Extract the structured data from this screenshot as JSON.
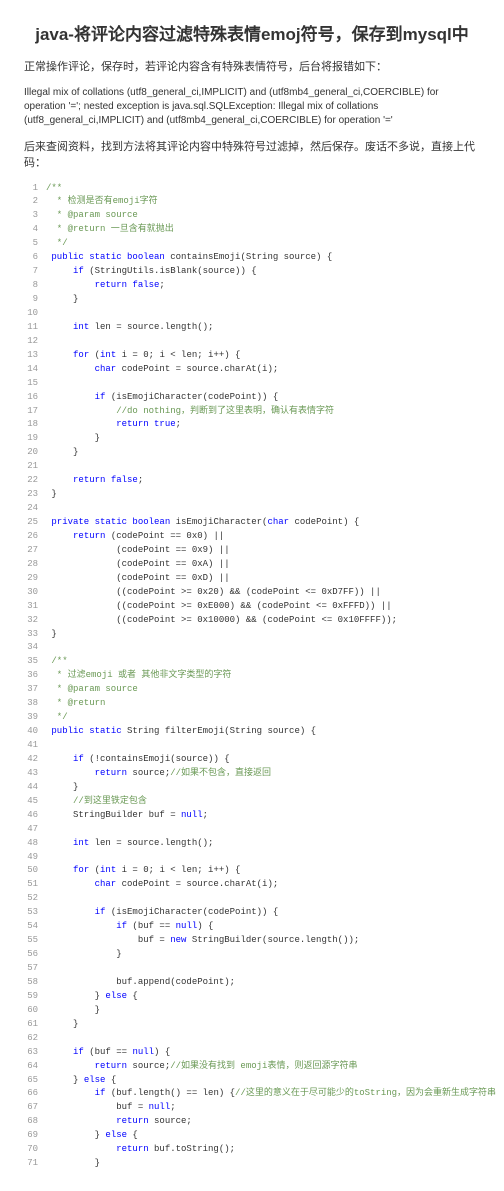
{
  "title": "java-将评论内容过滤特殊表情emoj符号，保存到mysql中",
  "intro": "正常操作评论，保存时，若评论内容含有特殊表情符号，后台将报错如下：",
  "error": "Illegal mix of collations (utf8_general_ci,IMPLICIT) and (utf8mb4_general_ci,COERCIBLE) for operation '='; nested exception is java.sql.SQLException: Illegal mix of collations (utf8_general_ci,IMPLICIT) and (utf8mb4_general_ci,COERCIBLE) for operation '='",
  "outro": "后来查阅资料，找到方法将其评论内容中特殊符号过滤掉，然后保存。废话不多说，直接上代码：",
  "code": [
    {
      "n": 1,
      "h": "<span class='cm'>/**</span>"
    },
    {
      "n": 2,
      "h": "<span class='cm'>  * 检测是否有emoji字符</span>"
    },
    {
      "n": 3,
      "h": "<span class='cm'>  * @param source</span>"
    },
    {
      "n": 4,
      "h": "<span class='cm'>  * @return 一旦含有就抛出</span>"
    },
    {
      "n": 5,
      "h": "<span class='cm'>  */</span>"
    },
    {
      "n": 6,
      "h": " <span class='kw'>public static boolean</span> containsEmoji(String source) {"
    },
    {
      "n": 7,
      "h": "     <span class='kw'>if</span> (StringUtils.isBlank(source)) {"
    },
    {
      "n": 8,
      "h": "         <span class='kw'>return false</span>;"
    },
    {
      "n": 9,
      "h": "     }"
    },
    {
      "n": 10,
      "h": ""
    },
    {
      "n": 11,
      "h": "     <span class='kw'>int</span> len = source.length();"
    },
    {
      "n": 12,
      "h": ""
    },
    {
      "n": 13,
      "h": "     <span class='kw'>for</span> (<span class='kw'>int</span> i = 0; i &lt; len; i++) {"
    },
    {
      "n": 14,
      "h": "         <span class='kw'>char</span> codePoint = source.charAt(i);"
    },
    {
      "n": 15,
      "h": ""
    },
    {
      "n": 16,
      "h": "         <span class='kw'>if</span> (isEmojiCharacter(codePoint)) {"
    },
    {
      "n": 17,
      "h": "             <span class='cm'>//do nothing，判断到了这里表明，确认有表情字符</span>"
    },
    {
      "n": 18,
      "h": "             <span class='kw'>return true</span>;"
    },
    {
      "n": 19,
      "h": "         }"
    },
    {
      "n": 20,
      "h": "     }"
    },
    {
      "n": 21,
      "h": ""
    },
    {
      "n": 22,
      "h": "     <span class='kw'>return false</span>;"
    },
    {
      "n": 23,
      "h": " }"
    },
    {
      "n": 24,
      "h": ""
    },
    {
      "n": 25,
      "h": " <span class='kw'>private static boolean</span> isEmojiCharacter(<span class='kw'>char</span> codePoint) {"
    },
    {
      "n": 26,
      "h": "     <span class='kw'>return</span> (codePoint == 0x0) ||"
    },
    {
      "n": 27,
      "h": "             (codePoint == 0x9) ||"
    },
    {
      "n": 28,
      "h": "             (codePoint == 0xA) ||"
    },
    {
      "n": 29,
      "h": "             (codePoint == 0xD) ||"
    },
    {
      "n": 30,
      "h": "             ((codePoint &gt;= 0x20) &amp;&amp; (codePoint &lt;= 0xD7FF)) ||"
    },
    {
      "n": 31,
      "h": "             ((codePoint &gt;= 0xE000) &amp;&amp; (codePoint &lt;= 0xFFFD)) ||"
    },
    {
      "n": 32,
      "h": "             ((codePoint &gt;= 0x10000) &amp;&amp; (codePoint &lt;= 0x10FFFF));"
    },
    {
      "n": 33,
      "h": " }"
    },
    {
      "n": 34,
      "h": ""
    },
    {
      "n": 35,
      "h": "<span class='cm'> /**</span>"
    },
    {
      "n": 36,
      "h": "<span class='cm'>  * 过滤emoji 或者 其他非文字类型的字符</span>"
    },
    {
      "n": 37,
      "h": "<span class='cm'>  * @param source</span>"
    },
    {
      "n": 38,
      "h": "<span class='cm'>  * @return</span>"
    },
    {
      "n": 39,
      "h": "<span class='cm'>  */</span>"
    },
    {
      "n": 40,
      "h": " <span class='kw'>public static</span> String filterEmoji(String source) {"
    },
    {
      "n": 41,
      "h": ""
    },
    {
      "n": 42,
      "h": "     <span class='kw'>if</span> (!containsEmoji(source)) {"
    },
    {
      "n": 43,
      "h": "         <span class='kw'>return</span> source;<span class='cm'>//如果不包含，直接返回</span>"
    },
    {
      "n": 44,
      "h": "     }"
    },
    {
      "n": 45,
      "h": "     <span class='cm'>//到这里铁定包含</span>"
    },
    {
      "n": 46,
      "h": "     StringBuilder buf = <span class='kw'>null</span>;"
    },
    {
      "n": 47,
      "h": ""
    },
    {
      "n": 48,
      "h": "     <span class='kw'>int</span> len = source.length();"
    },
    {
      "n": 49,
      "h": ""
    },
    {
      "n": 50,
      "h": "     <span class='kw'>for</span> (<span class='kw'>int</span> i = 0; i &lt; len; i++) {"
    },
    {
      "n": 51,
      "h": "         <span class='kw'>char</span> codePoint = source.charAt(i);"
    },
    {
      "n": 52,
      "h": ""
    },
    {
      "n": 53,
      "h": "         <span class='kw'>if</span> (isEmojiCharacter(codePoint)) {"
    },
    {
      "n": 54,
      "h": "             <span class='kw'>if</span> (buf == <span class='kw'>null</span>) {"
    },
    {
      "n": 55,
      "h": "                 buf = <span class='kw'>new</span> StringBuilder(source.length());"
    },
    {
      "n": 56,
      "h": "             }"
    },
    {
      "n": 57,
      "h": ""
    },
    {
      "n": 58,
      "h": "             buf.append(codePoint);"
    },
    {
      "n": 59,
      "h": "         } <span class='kw'>else</span> {"
    },
    {
      "n": 60,
      "h": "         }"
    },
    {
      "n": 61,
      "h": "     }"
    },
    {
      "n": 62,
      "h": ""
    },
    {
      "n": 63,
      "h": "     <span class='kw'>if</span> (buf == <span class='kw'>null</span>) {"
    },
    {
      "n": 64,
      "h": "         <span class='kw'>return</span> source;<span class='cm'>//如果没有找到 emoji表情，则返回源字符串</span>"
    },
    {
      "n": 65,
      "h": "     } <span class='kw'>else</span> {"
    },
    {
      "n": 66,
      "h": "         <span class='kw'>if</span> (buf.length() == len) {<span class='cm'>//这里的意义在于尽可能少的toString，因为会重新生成字符串</span>"
    },
    {
      "n": 67,
      "h": "             buf = <span class='kw'>null</span>;"
    },
    {
      "n": 68,
      "h": "             <span class='kw'>return</span> source;"
    },
    {
      "n": 69,
      "h": "         } <span class='kw'>else</span> {"
    },
    {
      "n": 70,
      "h": "             <span class='kw'>return</span> buf.toString();"
    },
    {
      "n": 71,
      "h": "         }"
    }
  ]
}
